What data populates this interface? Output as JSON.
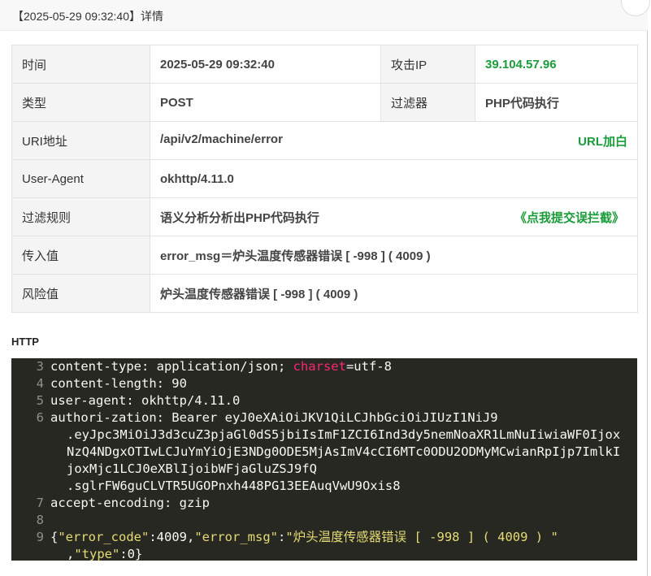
{
  "window": {
    "title": "【2025-05-29 09:32:40】详情"
  },
  "info": {
    "time_label": "时间",
    "time_value": "2025-05-29 09:32:40",
    "ip_label": "攻击IP",
    "ip_value": "39.104.57.96",
    "type_label": "类型",
    "type_value": "POST",
    "filter_label": "过滤器",
    "filter_value": "PHP代码执行",
    "uri_label": "URI地址",
    "uri_value": "/api/v2/machine/error",
    "uri_action": "URL加白",
    "ua_label": "User-Agent",
    "ua_value": "okhttp/4.11.0",
    "rule_label": "过滤规则",
    "rule_value": "语义分析分析出PHP代码执行",
    "rule_action": "《点我提交误拦截》",
    "input_label": "传入值",
    "input_value": "error_msg＝炉头温度传感器错误 [ -998 ] ( 4009 )",
    "risk_label": "风险值",
    "risk_value": "炉头温度传感器错误 [ -998 ] ( 4009 )"
  },
  "http": {
    "heading": "HTTP",
    "lines": {
      "l3_num": "3",
      "l3_a": "content-type: application/json; ",
      "l3_kw": "charset",
      "l3_b": "=utf-8",
      "l4_num": "4",
      "l4": "content-length: 90",
      "l5_num": "5",
      "l5": "user-agent: okhttp/4.11.0",
      "l6_num": "6",
      "l6_a": "authori-zation: Bearer eyJ0eXAiOiJKV1QiLCJhbGciOiJIUzI1NiJ9",
      "l6_b": ".eyJpc3MiOiJ3d3cuZ3pjaGl0dS5jbiIsImF1ZCI6Ind3dy5nemNoaXR1LmNuIiwiaWF0Ijox",
      "l6_c": "NzQ4NDgxOTIwLCJuYmYiOjE3NDg0ODE5MjAsImV4cCI6MTc0ODU2ODMyMCwianRpIjp7ImlkI",
      "l6_d": "joxMjc1LCJ0eXBlIjoibWFjaGluZSJ9fQ",
      "l6_e": ".sglrFW6guCLVTR5UGOPnxh448PG13EEAuqVwU9Oxis8",
      "l7_num": "7",
      "l7": "accept-encoding: gzip",
      "l8_num": "8",
      "l9_num": "9",
      "l9_p1": "{",
      "l9_k1": "\"error_code\"",
      "l9_p2": ":4009,",
      "l9_k2": "\"error_msg\"",
      "l9_p3": ":",
      "l9_s": "\"炉头温度传感器错误 [ -998 ] ( 4009 ) \"",
      "l9_p4": ",",
      "l9_k3": "\"type\"",
      "l9_p5": ":0}"
    }
  },
  "colors": {
    "accent_green": "#1a9c3a",
    "code_bg": "#272822",
    "keyword_pink": "#f92672",
    "string_yellow": "#e6db74"
  }
}
